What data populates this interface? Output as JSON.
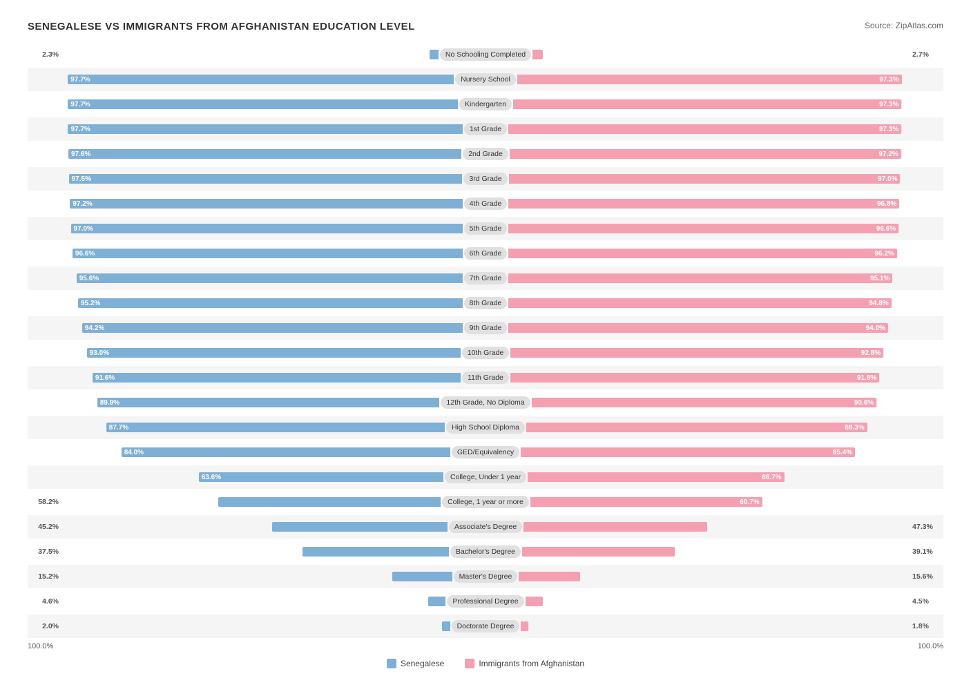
{
  "title": "SENEGALESE VS IMMIGRANTS FROM AFGHANISTAN EDUCATION LEVEL",
  "source": "Source: ZipAtlas.com",
  "colors": {
    "blue": "#7eb0d5",
    "pink": "#f5a0b0",
    "blue_dark": "#5a9dc0",
    "pink_dark": "#e8849a"
  },
  "legend": {
    "blue_label": "Senegalese",
    "pink_label": "Immigrants from Afghanistan"
  },
  "axis": {
    "left": "100.0%",
    "right": "100.0%"
  },
  "rows": [
    {
      "label": "No Schooling Completed",
      "blue": 2.3,
      "pink": 2.7,
      "blue_pct": "2.3%",
      "pink_pct": "2.7%",
      "show_blue_inside": false,
      "show_pink_inside": false
    },
    {
      "label": "Nursery School",
      "blue": 97.7,
      "pink": 97.3,
      "blue_pct": "97.7%",
      "pink_pct": "97.3%",
      "show_blue_inside": true,
      "show_pink_inside": true
    },
    {
      "label": "Kindergarten",
      "blue": 97.7,
      "pink": 97.3,
      "blue_pct": "97.7%",
      "pink_pct": "97.3%",
      "show_blue_inside": true,
      "show_pink_inside": true
    },
    {
      "label": "1st Grade",
      "blue": 97.7,
      "pink": 97.3,
      "blue_pct": "97.7%",
      "pink_pct": "97.3%",
      "show_blue_inside": true,
      "show_pink_inside": true
    },
    {
      "label": "2nd Grade",
      "blue": 97.6,
      "pink": 97.2,
      "blue_pct": "97.6%",
      "pink_pct": "97.2%",
      "show_blue_inside": true,
      "show_pink_inside": true
    },
    {
      "label": "3rd Grade",
      "blue": 97.5,
      "pink": 97.0,
      "blue_pct": "97.5%",
      "pink_pct": "97.0%",
      "show_blue_inside": true,
      "show_pink_inside": true
    },
    {
      "label": "4th Grade",
      "blue": 97.2,
      "pink": 96.8,
      "blue_pct": "97.2%",
      "pink_pct": "96.8%",
      "show_blue_inside": true,
      "show_pink_inside": true
    },
    {
      "label": "5th Grade",
      "blue": 97.0,
      "pink": 96.6,
      "blue_pct": "97.0%",
      "pink_pct": "96.6%",
      "show_blue_inside": true,
      "show_pink_inside": true
    },
    {
      "label": "6th Grade",
      "blue": 96.6,
      "pink": 96.2,
      "blue_pct": "96.6%",
      "pink_pct": "96.2%",
      "show_blue_inside": true,
      "show_pink_inside": true
    },
    {
      "label": "7th Grade",
      "blue": 95.6,
      "pink": 95.1,
      "blue_pct": "95.6%",
      "pink_pct": "95.1%",
      "show_blue_inside": true,
      "show_pink_inside": true
    },
    {
      "label": "8th Grade",
      "blue": 95.2,
      "pink": 94.8,
      "blue_pct": "95.2%",
      "pink_pct": "94.8%",
      "show_blue_inside": true,
      "show_pink_inside": true
    },
    {
      "label": "9th Grade",
      "blue": 94.2,
      "pink": 94.0,
      "blue_pct": "94.2%",
      "pink_pct": "94.0%",
      "show_blue_inside": true,
      "show_pink_inside": true
    },
    {
      "label": "10th Grade",
      "blue": 93.0,
      "pink": 92.8,
      "blue_pct": "93.0%",
      "pink_pct": "92.8%",
      "show_blue_inside": true,
      "show_pink_inside": true
    },
    {
      "label": "11th Grade",
      "blue": 91.6,
      "pink": 91.8,
      "blue_pct": "91.6%",
      "pink_pct": "91.8%",
      "show_blue_inside": true,
      "show_pink_inside": true
    },
    {
      "label": "12th Grade, No Diploma",
      "blue": 89.9,
      "pink": 90.6,
      "blue_pct": "89.9%",
      "pink_pct": "90.6%",
      "show_blue_inside": true,
      "show_pink_inside": true
    },
    {
      "label": "High School Diploma",
      "blue": 87.7,
      "pink": 88.3,
      "blue_pct": "87.7%",
      "pink_pct": "88.3%",
      "show_blue_inside": true,
      "show_pink_inside": true
    },
    {
      "label": "GED/Equivalency",
      "blue": 84.0,
      "pink": 85.4,
      "blue_pct": "84.0%",
      "pink_pct": "85.4%",
      "show_blue_inside": true,
      "show_pink_inside": true
    },
    {
      "label": "College, Under 1 year",
      "blue": 63.6,
      "pink": 66.7,
      "blue_pct": "63.6%",
      "pink_pct": "66.7%",
      "show_blue_inside": true,
      "show_pink_inside": true
    },
    {
      "label": "College, 1 year or more",
      "blue": 58.2,
      "pink": 60.7,
      "blue_pct": "58.2%",
      "pink_pct": "60.7%",
      "show_blue_inside": false,
      "show_pink_inside": true
    },
    {
      "label": "Associate's Degree",
      "blue": 45.2,
      "pink": 47.3,
      "blue_pct": "45.2%",
      "pink_pct": "47.3%",
      "show_blue_inside": false,
      "show_pink_inside": false
    },
    {
      "label": "Bachelor's Degree",
      "blue": 37.5,
      "pink": 39.1,
      "blue_pct": "37.5%",
      "pink_pct": "39.1%",
      "show_blue_inside": false,
      "show_pink_inside": false
    },
    {
      "label": "Master's Degree",
      "blue": 15.2,
      "pink": 15.6,
      "blue_pct": "15.2%",
      "pink_pct": "15.6%",
      "show_blue_inside": false,
      "show_pink_inside": false
    },
    {
      "label": "Professional Degree",
      "blue": 4.6,
      "pink": 4.5,
      "blue_pct": "4.6%",
      "pink_pct": "4.5%",
      "show_blue_inside": false,
      "show_pink_inside": false
    },
    {
      "label": "Doctorate Degree",
      "blue": 2.0,
      "pink": 1.8,
      "blue_pct": "2.0%",
      "pink_pct": "1.8%",
      "show_blue_inside": false,
      "show_pink_inside": false
    }
  ]
}
